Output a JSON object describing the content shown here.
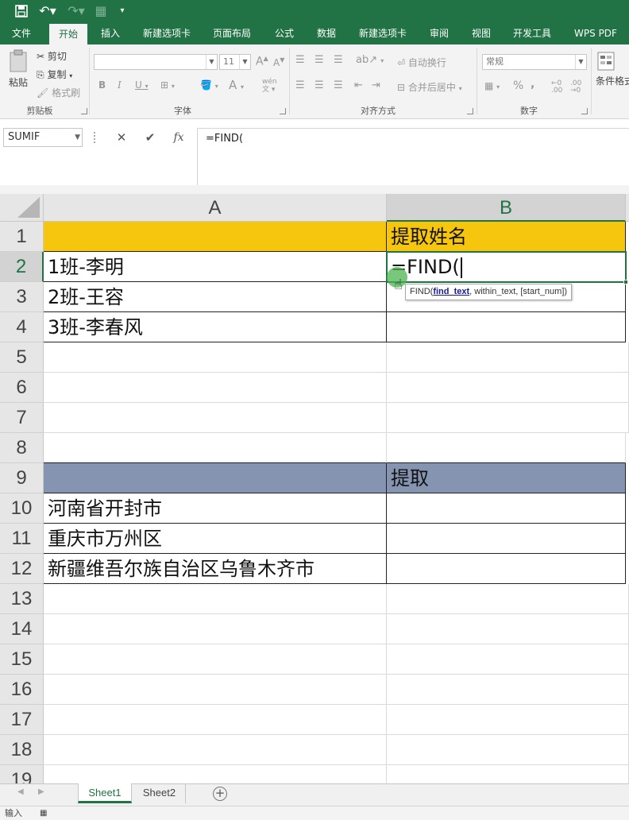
{
  "quick_access": {
    "save_icon": "save-icon",
    "undo_icon": "undo-icon",
    "redo_icon": "redo-icon",
    "print_icon": "print-preview-icon",
    "customize_icon": "customize-arrow-icon"
  },
  "tabs": [
    {
      "label": "文件"
    },
    {
      "label": "开始"
    },
    {
      "label": "插入"
    },
    {
      "label": "新建选项卡"
    },
    {
      "label": "页面布局"
    },
    {
      "label": "公式"
    },
    {
      "label": "数据"
    },
    {
      "label": "新建选项卡"
    },
    {
      "label": "审阅"
    },
    {
      "label": "视图"
    },
    {
      "label": "开发工具"
    },
    {
      "label": "WPS PDF"
    }
  ],
  "ribbon": {
    "clipboard": {
      "paste": "粘贴",
      "cut": "剪切",
      "copy": "复制",
      "format_painter": "格式刷",
      "group_label": "剪贴板"
    },
    "font": {
      "font_name": "",
      "font_size": "11",
      "grow": "A",
      "shrink": "A",
      "bold": "B",
      "italic": "I",
      "underline": "U",
      "font_color": "A",
      "phonetic": "wén",
      "group_label": "字体"
    },
    "alignment": {
      "wrap_text": "自动换行",
      "merge_center": "合并后居中",
      "group_label": "对齐方式"
    },
    "number": {
      "format": "常规",
      "percent": "%",
      "comma": ",",
      "group_label": "数字"
    },
    "styles": {
      "conditional_format": "条件格式"
    }
  },
  "formula_bar": {
    "name_box": "SUMIF",
    "cancel": "✕",
    "enter": "✔",
    "fx": "fx",
    "formula": "=FIND("
  },
  "grid": {
    "columns": [
      "A",
      "B"
    ],
    "rows": [
      "1",
      "2",
      "3",
      "4",
      "5",
      "6",
      "7",
      "8",
      "9",
      "10",
      "11",
      "12",
      "13",
      "14",
      "15",
      "16",
      "17",
      "18",
      "19"
    ],
    "cells": {
      "B1": "提取姓名",
      "A2": "1班-李明",
      "B2": "=FIND(",
      "A3": "2班-王容",
      "A4": "3班-李春风",
      "B9": "提取",
      "A10": "河南省开封市",
      "A11": "重庆市万州区",
      "A12": "新疆维吾尔族自治区乌鲁木齐市"
    },
    "colors": {
      "header_yellow": "#f6c50e",
      "header_slate": "#8494b1",
      "accent_green": "#217346"
    }
  },
  "tooltip": {
    "func": "FIND(",
    "arg1": "find_text",
    "rest": ", within_text, [start_num])"
  },
  "sheets": [
    {
      "label": "Sheet1",
      "active": true
    },
    {
      "label": "Sheet2",
      "active": false
    }
  ],
  "status": {
    "mode": "输入"
  }
}
